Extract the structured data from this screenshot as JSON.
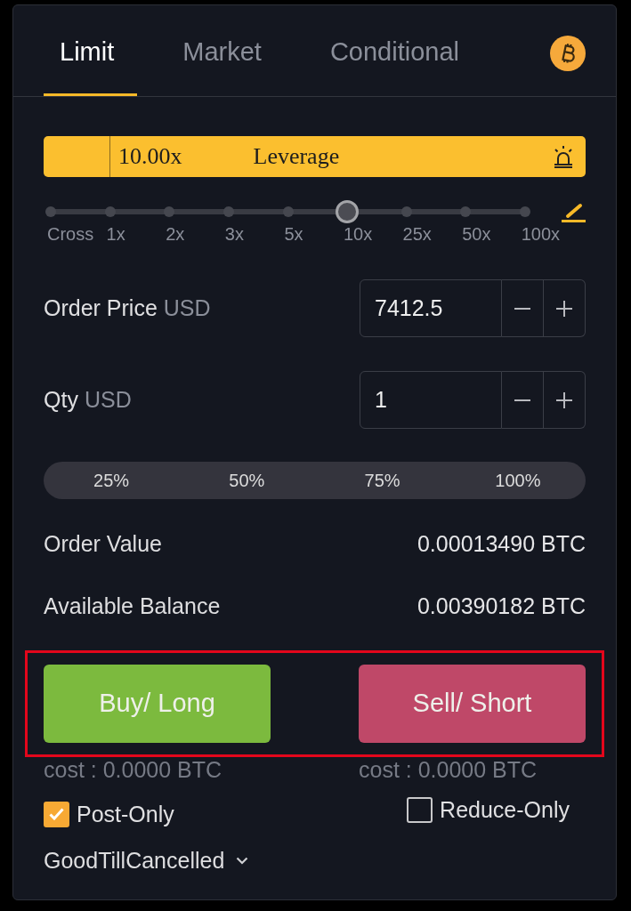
{
  "tabs": [
    {
      "label": "Limit",
      "selected": true
    },
    {
      "label": "Market",
      "selected": false
    },
    {
      "label": "Conditional",
      "selected": false
    }
  ],
  "leverage": {
    "value": "10.00x",
    "label": "Leverage"
  },
  "leverage_slider": {
    "level": 0.625,
    "ticks": [
      "Cross",
      "1x",
      "2x",
      "3x",
      "5x",
      "10x",
      "25x",
      "50x",
      "100x"
    ]
  },
  "fields": [
    {
      "label": "Order Price",
      "unit": "USD",
      "value": "7412.5"
    },
    {
      "label": "Qty",
      "unit": "USD",
      "value": "1"
    }
  ],
  "quick_amounts": [
    "25%",
    "50%",
    "75%",
    "100%"
  ],
  "summary": [
    {
      "label": "Order Value",
      "value": "0.00013490 BTC"
    },
    {
      "label": "Available Balance",
      "value": "0.00390182 BTC"
    }
  ],
  "trade_buttons": {
    "highlighted": true,
    "buttons": [
      {
        "kind": "buy",
        "label": "Buy/ Long",
        "cost": "cost : 0.0000 BTC"
      },
      {
        "kind": "sell",
        "label": "Sell/ Short",
        "cost": "cost : 0.0000 BTC"
      }
    ]
  },
  "options": [
    {
      "label": "Post-Only",
      "checked": true
    },
    {
      "label": "Reduce-Only",
      "checked": false
    }
  ],
  "time_in_force": {
    "value": "GoodTillCancelled"
  }
}
